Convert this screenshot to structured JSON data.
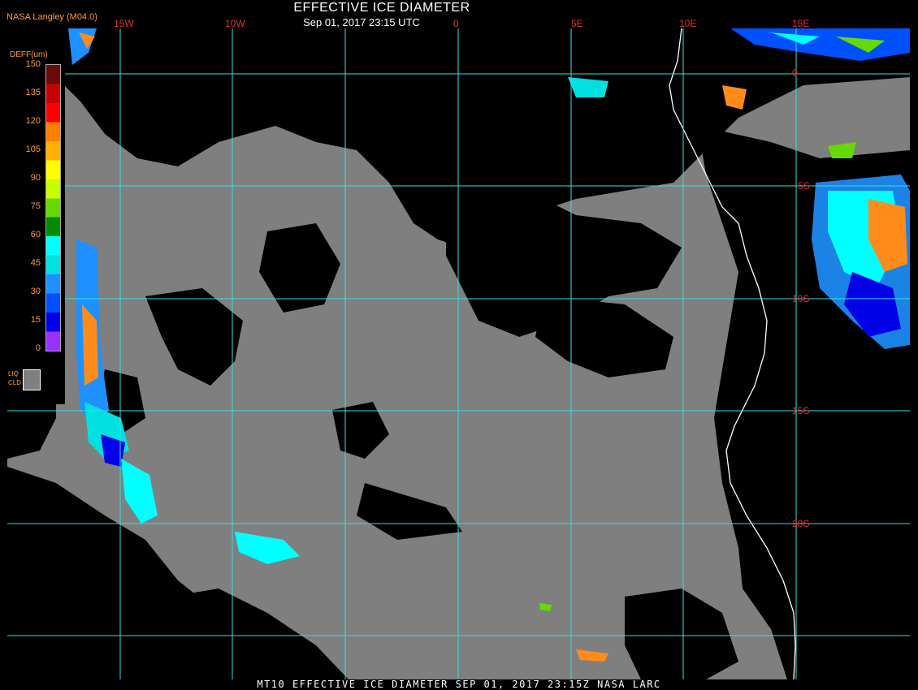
{
  "header": {
    "title": "EFFECTIVE ICE DIAMETER",
    "subtitle": "Sep 01, 2017 23:15 UTC",
    "org": "NASA Langley (M04.0)"
  },
  "footer": "MT10  EFFECTIVE ICE DIAMETER  SEP 01, 2017 23:15Z  NASA LARC",
  "longitude_labels": [
    "15W",
    "10W",
    "0",
    "5E",
    "10E",
    "15E"
  ],
  "latitude_labels": [
    "0",
    "5S",
    "10S",
    "15S",
    "20S"
  ],
  "legend": {
    "title": "DEFF(um)",
    "ticks": [
      "150",
      "135",
      "120",
      "105",
      "90",
      "75",
      "60",
      "45",
      "30",
      "15",
      "0"
    ],
    "colors": [
      "#6b0a0a",
      "#c80000",
      "#ff0000",
      "#ff7f00",
      "#ffb000",
      "#ffff00",
      "#c8ff00",
      "#66d900",
      "#008a00",
      "#00ffff",
      "#00e0e0",
      "#1e90ff",
      "#0050ff",
      "#0000e6",
      "#9b30ff"
    ],
    "liq_label": [
      "LIQ",
      "CLD"
    ],
    "liq_color": "#7f7f7f"
  },
  "colors": {
    "grid": "#33e0e0",
    "land": "#000000",
    "liquid_cloud": "#7f7f7f",
    "coast": "#ffffff",
    "label": "#e03030",
    "accent": "#ff9a2e"
  }
}
